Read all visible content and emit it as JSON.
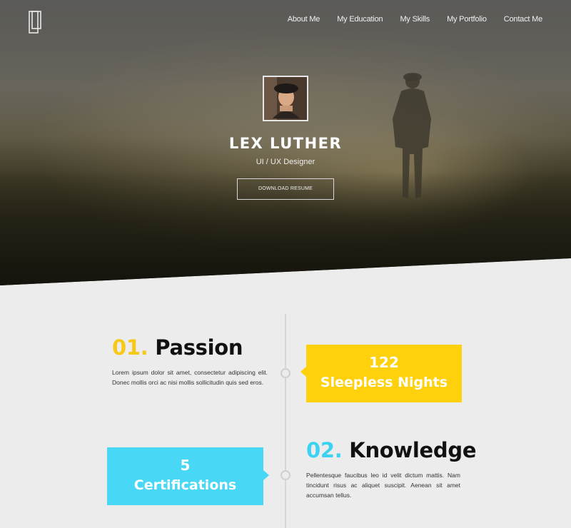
{
  "nav": {
    "items": [
      {
        "label": "About Me"
      },
      {
        "label": "My Education"
      },
      {
        "label": "My Skills"
      },
      {
        "label": "My Portfolio"
      },
      {
        "label": "Contact Me"
      }
    ]
  },
  "hero": {
    "name": "LEX LUTHER",
    "role": "UI / UX Designer",
    "resume_button": "DOWNLOAD RESUME"
  },
  "timeline": {
    "items": [
      {
        "number": "01.",
        "title": "Passion",
        "text": "Lorem ipsum dolor sit amet, consectetur adipiscing elit. Donec mollis orci ac nisi mollis sollicitudin quis sed eros.",
        "stat_value": "122",
        "stat_label": "Sleepless Nights",
        "accent": "#ffd10d"
      },
      {
        "number": "02.",
        "title": "Knowledge",
        "text": "Pellentesque faucibus leo id velit dictum mattis. Nam tincidunt risus ac aliquet suscipit. Aenean sit amet accumsan tellus.",
        "stat_value": "5",
        "stat_label": "Certifications",
        "accent": "#48d7f4"
      }
    ]
  },
  "colors": {
    "yellow": "#ffd10d",
    "cyan": "#48d7f4",
    "background": "#ececec"
  }
}
